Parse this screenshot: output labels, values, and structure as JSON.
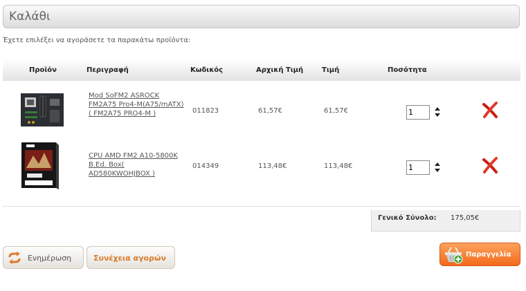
{
  "page": {
    "title": "Καλάθι",
    "intro": "Έχετε επιλέξει να αγοράσετε τα παρακάτω προϊόντα:"
  },
  "table": {
    "headers": {
      "product": "Προϊόν",
      "description": "Περιγραφή",
      "code": "Κωδικός",
      "initial_price": "Αρχική Τιμή",
      "price": "Τιμή",
      "quantity": "Ποσότητα"
    },
    "rows": [
      {
        "image": "motherboard-image",
        "description": "Mod SoFM2 ASROCK FM2A75 Pro4-M(A75/mATX)( FM2A75 PRO4-M )",
        "code": "011823",
        "initial_price": "61,57€",
        "price": "61,57€",
        "quantity": "1"
      },
      {
        "image": "cpu-box-image",
        "description": "CPU AMD FM2 A10-5800K B.Ed. Box( AD580KWOHJBOX )",
        "code": "014349",
        "initial_price": "113,48€",
        "price": "113,48€",
        "quantity": "1"
      }
    ]
  },
  "totals": {
    "label": "Γενικό Σύνολο:",
    "value": "175,05€"
  },
  "buttons": {
    "update": "Ενημέρωση",
    "continue": "Συνέχεια αγορών",
    "order": "Παραγγελία"
  },
  "icons": {
    "remove": "remove-x-icon",
    "update": "refresh-arrows-icon",
    "order": "shopping-basket-plus-icon",
    "quantity_spinner": "up-down-arrows-icon"
  },
  "colors": {
    "accent_orange": "#f26a1b",
    "remove_red": "#d8231b"
  }
}
